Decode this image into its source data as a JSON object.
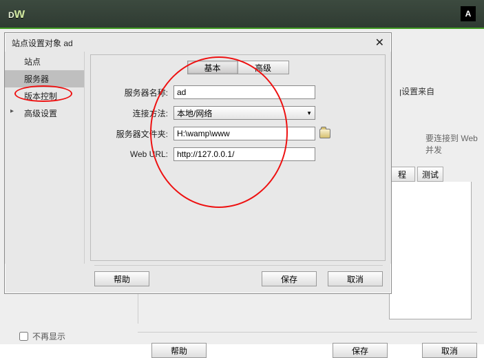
{
  "header": {
    "logo_text": "Dw",
    "adobe": "A"
  },
  "bg": {
    "text_right1": "ן设置来自",
    "text_right2": "要连接到 Web 并发",
    "col_remote": "程",
    "col_test": "测试",
    "btn_help": "帮助",
    "btn_save": "保存",
    "btn_cancel": "取消",
    "chk_noshow": "不再显示"
  },
  "dialog": {
    "title": "站点设置对象 ad",
    "sidebar": {
      "site": "站点",
      "server": "服务器",
      "version": "版本控制",
      "advanced": "高级设置"
    },
    "tabs": {
      "basic": "基本",
      "advanced": "高级"
    },
    "form": {
      "name_label": "服务器名称:",
      "name_value": "ad",
      "conn_label": "连接方法:",
      "conn_value": "本地/网络",
      "folder_label": "服务器文件夹:",
      "folder_value": "H:\\wamp\\www",
      "url_label": "Web URL:",
      "url_value": "http://127.0.0.1/"
    },
    "buttons": {
      "help": "帮助",
      "save": "保存",
      "cancel": "取消"
    }
  }
}
